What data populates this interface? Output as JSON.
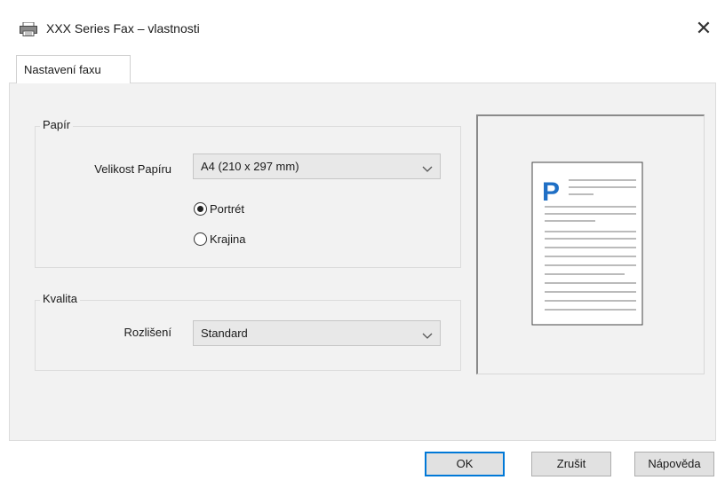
{
  "window": {
    "title": "XXX Series Fax – vlastnosti",
    "icon": "printer-icon",
    "close_label": "✕"
  },
  "tabs": [
    {
      "label": "Nastavení faxu",
      "selected": true
    }
  ],
  "paper_group": {
    "label": "Papír",
    "size_label": "Velikost Papíru",
    "size_value": "A4 (210 x 297 mm)",
    "orientation_options": [
      {
        "label": "Portrét",
        "checked": true
      },
      {
        "label": "Krajina",
        "checked": false
      }
    ]
  },
  "quality_group": {
    "label": "Kvalita",
    "resolution_label": "Rozlišení",
    "resolution_value": "Standard"
  },
  "preview": {
    "letter": "P",
    "accent_color": "#1f6fc5"
  },
  "buttons": {
    "ok": "OK",
    "cancel": "Zrušit",
    "help": "Nápověda"
  }
}
